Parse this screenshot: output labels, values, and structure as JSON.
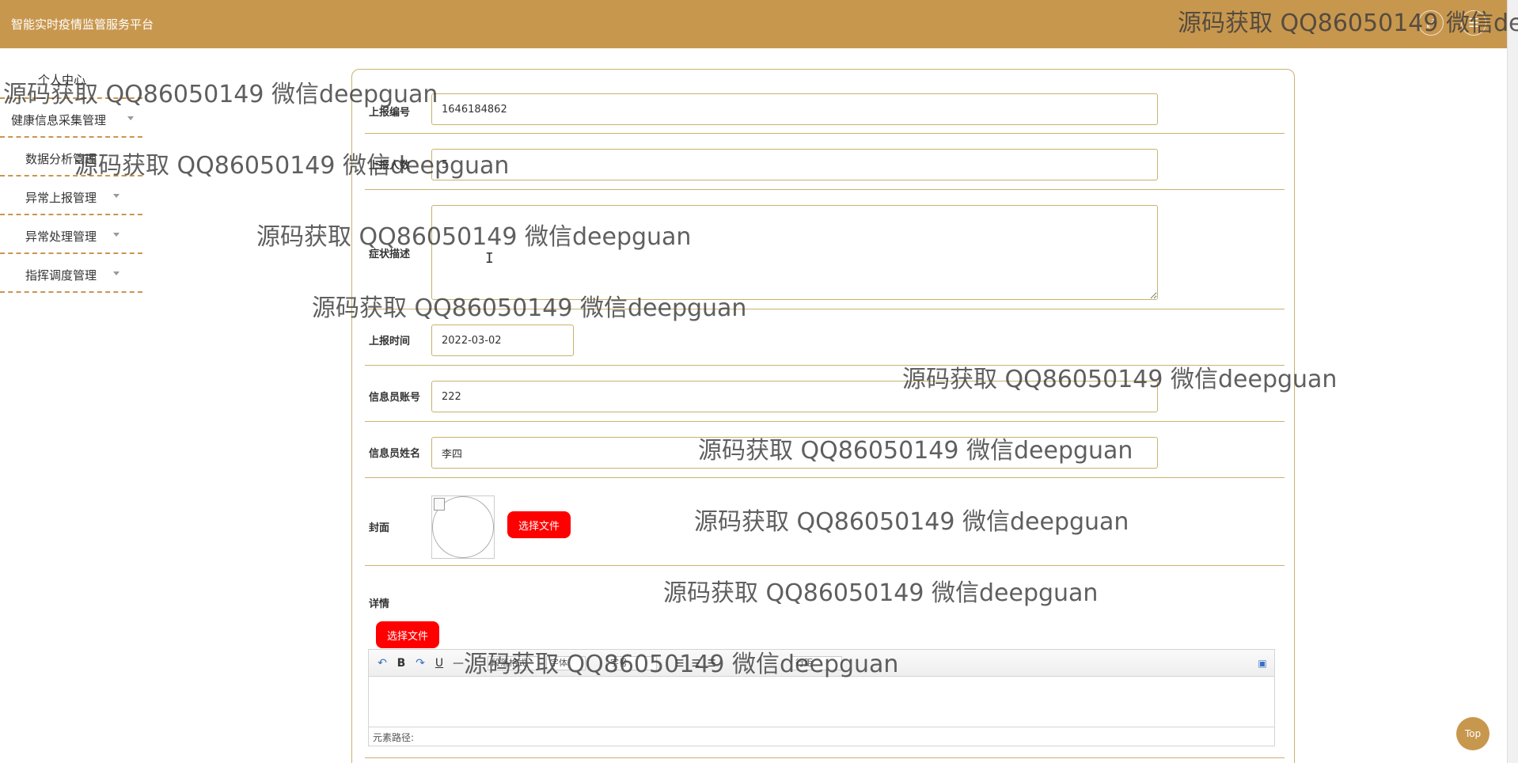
{
  "header": {
    "app_title": "智能实时疫情监管服务平台",
    "fullscreen_icon": "expand-icon",
    "menu_icon": "user-icon"
  },
  "sidebar": {
    "items": [
      {
        "label": "个人中心"
      },
      {
        "label": "健康信息采集管理"
      },
      {
        "label": "数据分析管理"
      },
      {
        "label": "异常上报管理"
      },
      {
        "label": "异常处理管理"
      },
      {
        "label": "指挥调度管理"
      }
    ]
  },
  "form": {
    "report_no": {
      "label": "上报编号",
      "value": "1646184862"
    },
    "report_count": {
      "label": "上报人数",
      "value": "5"
    },
    "symptoms": {
      "label": "症状描述",
      "value": ""
    },
    "report_time": {
      "label": "上报时间",
      "value": "2022-03-02"
    },
    "informant_account": {
      "label": "信息员账号",
      "value": "222"
    },
    "informant_name": {
      "label": "信息员姓名",
      "value": "李四"
    },
    "cover": {
      "label": "封面",
      "button": "选择文件"
    },
    "details": {
      "label": "详情",
      "button": "选择文件"
    }
  },
  "editor": {
    "toolbar": {
      "undo": "↶",
      "redo": "↷",
      "bold": "B",
      "underline": "U",
      "hr": "—",
      "paragraph_select": "段落格式",
      "font_select": "字体",
      "size_select": "字号",
      "line_select": "行距"
    },
    "path_label": "元素路径:"
  },
  "top_button": "Top",
  "watermark": "源码获取 QQ86050149 微信deepguan",
  "colors": {
    "header": "#c8974e",
    "border": "#c8b26e",
    "button_red": "#ff0000"
  }
}
